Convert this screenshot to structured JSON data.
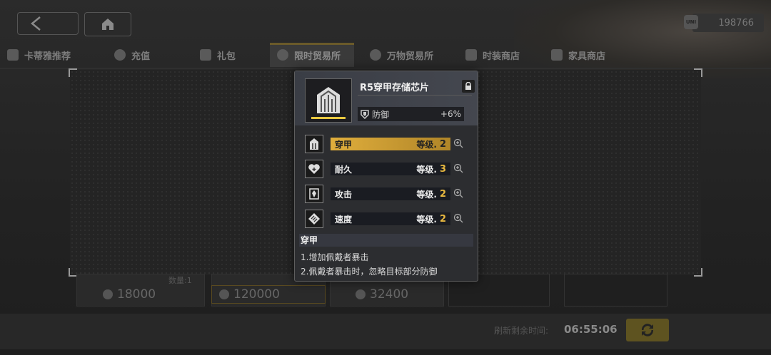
{
  "topbar": {
    "currency_value": "198766",
    "currency_icon_text": "UNI"
  },
  "tabs": [
    {
      "label": "卡蒂雅推荐",
      "icon": "character-icon"
    },
    {
      "label": "充值",
      "icon": "yen-icon"
    },
    {
      "label": "礼包",
      "icon": "gift-icon"
    },
    {
      "label": "限时贸易所",
      "icon": "timer-icon",
      "active": true
    },
    {
      "label": "万物贸易所",
      "icon": "exchange-icon"
    },
    {
      "label": "时装商店",
      "icon": "wardrobe-icon"
    },
    {
      "label": "家具商店",
      "icon": "furniture-icon"
    }
  ],
  "shop": {
    "quantity_label": "数量:1",
    "prices": [
      "18000",
      "120000",
      "32400"
    ]
  },
  "footer": {
    "refresh_label": "刷新剩余时间:",
    "refresh_time": "06:55:06"
  },
  "item_card": {
    "title": "R5穿甲存储芯片",
    "stat": {
      "name": "防御",
      "value": "+6%"
    },
    "skills": [
      {
        "name": "穿甲",
        "level_label": "等级.",
        "level": "2",
        "active": true
      },
      {
        "name": "耐久",
        "level_label": "等级.",
        "level": "3"
      },
      {
        "name": "攻击",
        "level_label": "等级.",
        "level": "2"
      },
      {
        "name": "速度",
        "level_label": "等级.",
        "level": "2"
      }
    ],
    "description_title": "穿甲",
    "description_lines": [
      "1.增加佩戴者暴击",
      "2.佩戴者暴击时，忽略目标部分防御"
    ]
  },
  "colors": {
    "accent_gold": "#e0ae3c",
    "level_gold": "#e8b840"
  }
}
